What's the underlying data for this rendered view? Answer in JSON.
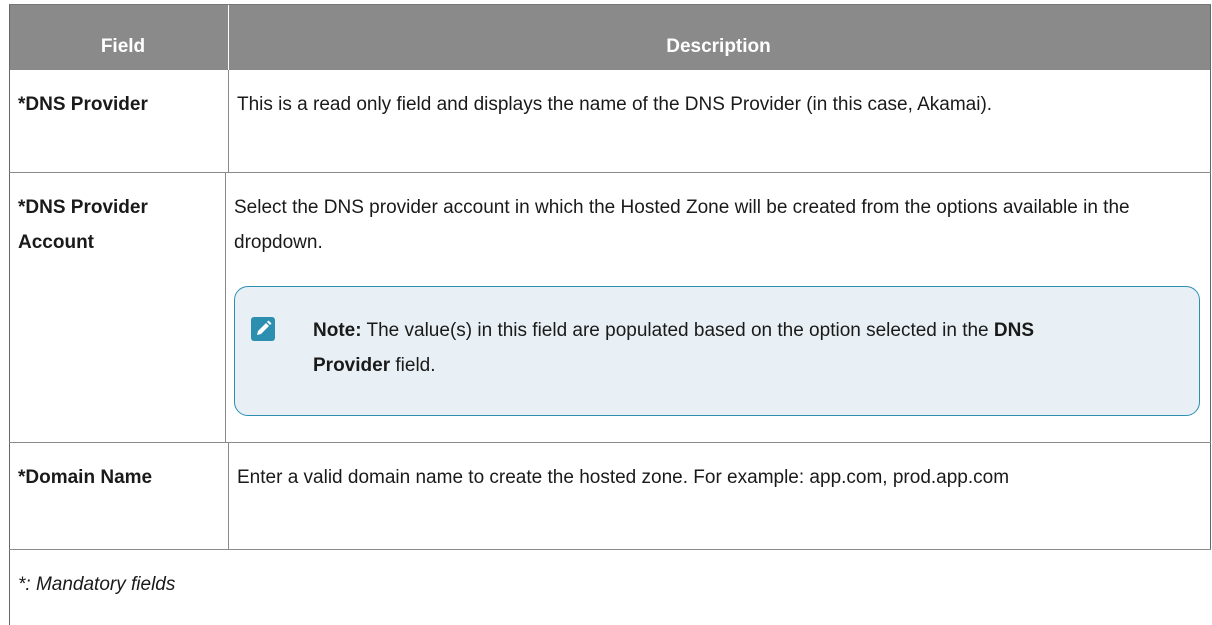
{
  "table": {
    "header": {
      "field": "Field",
      "description": "Description"
    },
    "rows": [
      {
        "field": "*DNS Provider",
        "description": "This is a read only field and displays the name of the DNS Provider (in this case, Akamai)."
      },
      {
        "field_line1": "*DNS Provider",
        "field_line2": "Account",
        "description": "Select the DNS provider account in which the Hosted Zone will be created from the options available in the dropdown.",
        "note": {
          "label": "Note:",
          "text_before": " The value(s) in this field are populated based on the option selected in the ",
          "bold": "DNS Provider",
          "text_after": " field."
        }
      },
      {
        "field": "*Domain Name",
        "description": "Enter a valid domain name to create the hosted zone. For example: app.com, prod.app.com"
      }
    ],
    "footnote": "*: Mandatory fields"
  },
  "colors": {
    "header_bg": "#8a8a8a",
    "note_border": "#2d8fb0",
    "note_bg": "#e8f0f5",
    "icon": "#2d8fb0"
  }
}
